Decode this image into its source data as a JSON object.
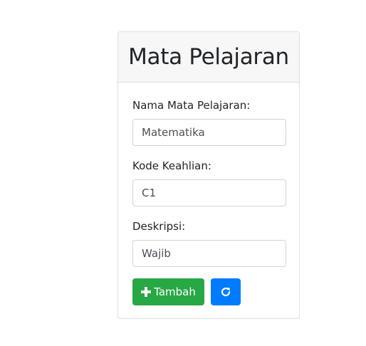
{
  "card": {
    "title": "Mata Pelajaran"
  },
  "form": {
    "nama": {
      "label": "Nama Mata Pelajaran:",
      "value": "Matematika"
    },
    "kode": {
      "label": "Kode Keahlian:",
      "value": "C1"
    },
    "deskripsi": {
      "label": "Deskripsi:",
      "value": "Wajib"
    }
  },
  "buttons": {
    "add_label": "Tambah",
    "add_icon": "plus-icon",
    "refresh_icon": "refresh-icon"
  },
  "colors": {
    "success": "#28a745",
    "primary": "#007bff",
    "header_bg": "#f7f7f7",
    "border": "#dfdfdf"
  }
}
